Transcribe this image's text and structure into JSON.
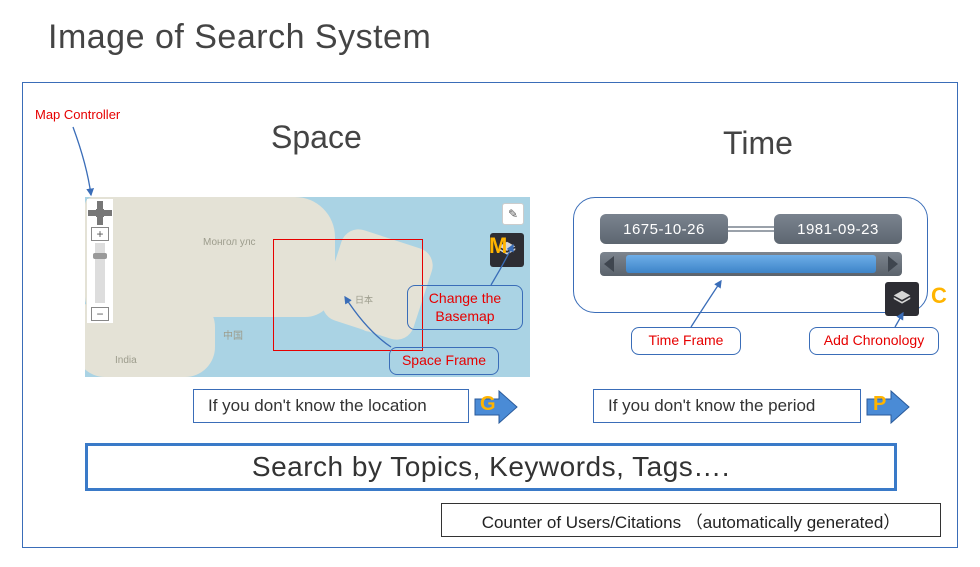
{
  "title": "Image of Search System",
  "labels": {
    "map_controller": "Map Controller",
    "space_heading": "Space",
    "time_heading": "Time"
  },
  "map": {
    "place_mongolia": "Монгол улс",
    "place_china": "中国",
    "place_india": "India",
    "place_japan": "日本"
  },
  "callouts": {
    "change_basemap": "Change the Basemap",
    "space_frame": "Space Frame",
    "time_frame": "Time Frame",
    "add_chronology": "Add Chronology"
  },
  "time": {
    "start_date": "1675-10-26",
    "end_date": "1981-09-23"
  },
  "letters": {
    "M": "M",
    "C": "C",
    "G": "G",
    "P": "P"
  },
  "hints": {
    "location": "If you don't know the location",
    "period": "If you don't know the period"
  },
  "search": {
    "prompt": "Search by Topics, Keywords, Tags….",
    "counter": "Counter of Users/Citations （automatically generated）"
  }
}
